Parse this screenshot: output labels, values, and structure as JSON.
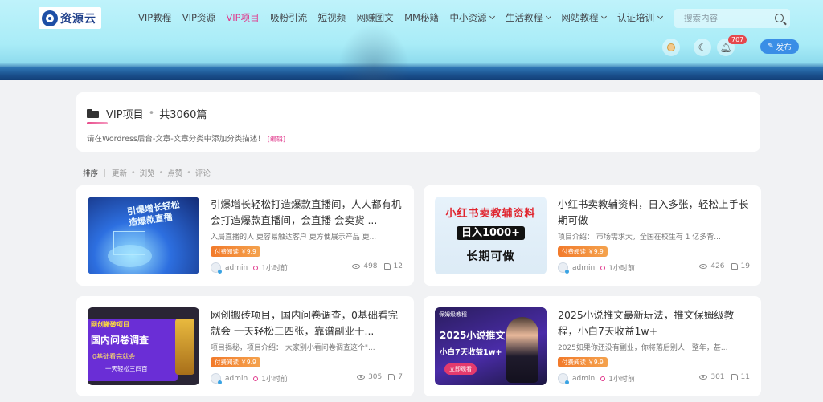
{
  "header": {
    "logo_text": "资源云",
    "nav": [
      {
        "label": "VIP教程",
        "dropdown": false,
        "active": false
      },
      {
        "label": "VIP资源",
        "dropdown": false,
        "active": false
      },
      {
        "label": "VIP项目",
        "dropdown": false,
        "active": true
      },
      {
        "label": "吸粉引流",
        "dropdown": false,
        "active": false
      },
      {
        "label": "短视频",
        "dropdown": false,
        "active": false
      },
      {
        "label": "网赚图文",
        "dropdown": false,
        "active": false
      },
      {
        "label": "MM秘籍",
        "dropdown": false,
        "active": false
      },
      {
        "label": "中小资源",
        "dropdown": true,
        "active": false
      },
      {
        "label": "生活教程",
        "dropdown": true,
        "active": false
      },
      {
        "label": "网站教程",
        "dropdown": true,
        "active": false
      },
      {
        "label": "认证培训",
        "dropdown": true,
        "active": false
      }
    ],
    "search_placeholder": "搜索内容",
    "notification_count": "707",
    "publish_label": "发布"
  },
  "category": {
    "name": "VIP项目",
    "separator": "•",
    "count_text": "共3060篇",
    "description": "请在Wordress后台-文章-文章分类中添加分类描述！",
    "edit_label": "[编辑]"
  },
  "sort": {
    "lead": "排序",
    "options": [
      "更新",
      "浏览",
      "点赞",
      "评论"
    ]
  },
  "posts": [
    {
      "title": "引爆增长轻松打造爆款直播间，人人都有机会打造爆款直播间，会直播 会卖货 ...",
      "excerpt": "入局直播的人 更容易触达客户 更方便展示产品 更...",
      "tag": "付费阅读 ￥9.9",
      "author": "admin",
      "time": "1小时前",
      "views": "498",
      "likes": "12",
      "thumb_text": [
        "引爆增长轻松",
        "造爆款直播"
      ]
    },
    {
      "title": "小红书卖教辅资料，日入多张，轻松上手长期可做",
      "excerpt": "项目介绍： 市场需求大，全国在校生有 1 亿多背...",
      "tag": "付费阅读 ￥9.9",
      "author": "admin",
      "time": "1小时前",
      "views": "426",
      "likes": "19",
      "thumb_text": [
        "小红书卖教辅资料",
        "日入1000+",
        "长期可做"
      ]
    },
    {
      "title": "网创搬砖项目，国内问卷调查，0基础看完就会 一天轻松三四张，靠谱副业干...",
      "excerpt": "项目揭秘，项目介绍： 大家别小看问卷调查这个\"...",
      "tag": "付费阅读 ￥9.9",
      "author": "admin",
      "time": "1小时前",
      "views": "305",
      "likes": "7",
      "thumb_text": [
        "网创搬砖项目",
        "国内问卷调查",
        "0基础看完就会",
        "一天轻松三四百"
      ]
    },
    {
      "title": "2025小说推文最新玩法，推文保姆级教程，小白7天收益1w+",
      "excerpt": "2025如果你还没有副业，你将落后别人一整年，甚...",
      "tag": "付费阅读 ￥9.9",
      "author": "admin",
      "time": "1小时前",
      "views": "301",
      "likes": "11",
      "thumb_text": [
        "保姆级教程",
        "2025小说推文",
        "小白7天收益1w+",
        "立即观看"
      ]
    }
  ],
  "colors": {
    "accent": "#e0398c",
    "publish": "#3a8ee6",
    "tag": "#f27a2b"
  }
}
